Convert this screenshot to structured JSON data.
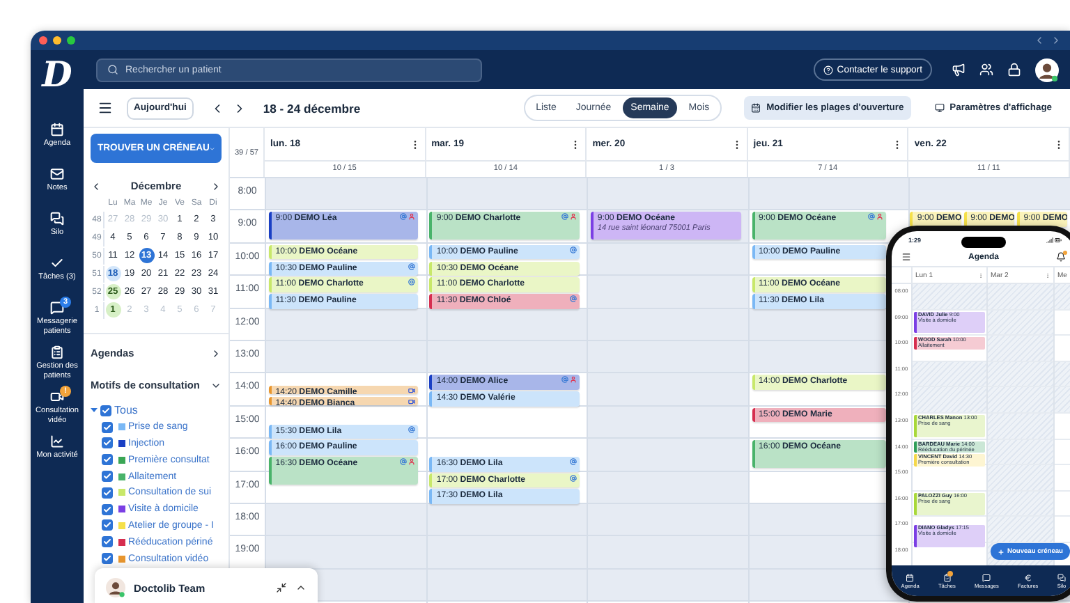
{
  "window": {
    "logo": "D"
  },
  "nav": [
    {
      "label": "Agenda"
    },
    {
      "label": "Notes"
    },
    {
      "label": "Silo"
    },
    {
      "label": "Tâches (3)"
    },
    {
      "label": "Messagerie patients",
      "badge": "3",
      "color": "#2b7de9"
    },
    {
      "label": "Gestion des patients"
    },
    {
      "label": "Consultation vidéo",
      "badge": "!",
      "color": "#f2a33a"
    },
    {
      "label": "Mon activité"
    }
  ],
  "topbar": {
    "search": {
      "placeholder": "Rechercher un patient"
    },
    "support": "Contacter le support"
  },
  "toolbar": {
    "today": "Aujourd'hui",
    "range": "18 - 24 décembre",
    "views": [
      {
        "label": "Liste",
        "selected": false
      },
      {
        "label": "Journée",
        "selected": false
      },
      {
        "label": "Semaine",
        "selected": true
      },
      {
        "label": "Mois",
        "selected": false
      }
    ],
    "edit_hours": "Modifier les plages d'ouverture",
    "display_settings": "Paramètres d'affichage"
  },
  "panel": {
    "find_slot": "TROUVER UN CRÉNEAU",
    "mini_calendar": {
      "month": "Décembre",
      "weekdays": [
        "Lu",
        "Ma",
        "Me",
        "Je",
        "Ve",
        "Sa",
        "Di"
      ],
      "weeks": [
        {
          "number": "48",
          "days": [
            {
              "label": "27",
              "kind": "other"
            },
            {
              "label": "28",
              "kind": "other"
            },
            {
              "label": "29",
              "kind": "other"
            },
            {
              "label": "30",
              "kind": "other"
            },
            {
              "label": "1",
              "kind": "day"
            },
            {
              "label": "2",
              "kind": "day"
            },
            {
              "label": "3",
              "kind": "day"
            }
          ]
        },
        {
          "number": "49",
          "days": [
            {
              "label": "4",
              "kind": "day"
            },
            {
              "label": "5",
              "kind": "day"
            },
            {
              "label": "6",
              "kind": "day"
            },
            {
              "label": "7",
              "kind": "day"
            },
            {
              "label": "8",
              "kind": "day"
            },
            {
              "label": "9",
              "kind": "day"
            },
            {
              "label": "10",
              "kind": "day"
            }
          ]
        },
        {
          "number": "50",
          "days": [
            {
              "label": "11",
              "kind": "day"
            },
            {
              "label": "12",
              "kind": "day"
            },
            {
              "label": "13",
              "kind": "today"
            },
            {
              "label": "14",
              "kind": "day"
            },
            {
              "label": "15",
              "kind": "day"
            },
            {
              "label": "16",
              "kind": "day"
            },
            {
              "label": "17",
              "kind": "day"
            }
          ]
        },
        {
          "number": "51",
          "days": [
            {
              "label": "18",
              "kind": "selected"
            },
            {
              "label": "19",
              "kind": "day"
            },
            {
              "label": "20",
              "kind": "day"
            },
            {
              "label": "21",
              "kind": "day"
            },
            {
              "label": "22",
              "kind": "day"
            },
            {
              "label": "23",
              "kind": "day"
            },
            {
              "label": "24",
              "kind": "day"
            }
          ]
        },
        {
          "number": "52",
          "days": [
            {
              "label": "25",
              "kind": "holiday"
            },
            {
              "label": "26",
              "kind": "day"
            },
            {
              "label": "27",
              "kind": "day"
            },
            {
              "label": "28",
              "kind": "day"
            },
            {
              "label": "29",
              "kind": "day"
            },
            {
              "label": "30",
              "kind": "day"
            },
            {
              "label": "31",
              "kind": "day"
            }
          ]
        },
        {
          "number": "1",
          "days": [
            {
              "label": "1",
              "kind": "holiday"
            },
            {
              "label": "2",
              "kind": "other"
            },
            {
              "label": "3",
              "kind": "other"
            },
            {
              "label": "4",
              "kind": "other"
            },
            {
              "label": "5",
              "kind": "other"
            },
            {
              "label": "6",
              "kind": "other"
            },
            {
              "label": "7",
              "kind": "other"
            }
          ]
        }
      ]
    },
    "agendas": "Agendas",
    "motifs": {
      "title": "Motifs de consultation",
      "all": {
        "label": "Tous",
        "checked": true,
        "expanded": true,
        "children": [
          {
            "label": "Prise de sang",
            "checked": true,
            "color": "#7ab8f5"
          },
          {
            "label": "Injection",
            "checked": true,
            "color": "#1a3fc4"
          },
          {
            "label": "Première consultat",
            "checked": true,
            "color": "#3aa655"
          },
          {
            "label": "Allaitement",
            "checked": true,
            "color": "#49b36a"
          },
          {
            "label": "Consultation de sui",
            "checked": true,
            "color": "#c8e86a"
          },
          {
            "label": "Visite à domicile",
            "checked": true,
            "color": "#7b3fe4"
          },
          {
            "label": "Atelier de groupe - I",
            "checked": true,
            "color": "#f5e04a"
          },
          {
            "label": "Rééducation périné",
            "checked": true,
            "color": "#d62e4f"
          },
          {
            "label": "Consultation vidéo",
            "checked": true,
            "color": "#e8962e"
          }
        ]
      }
    }
  },
  "calendar": {
    "total": "39 / 57",
    "hours": [
      {
        "label": "8:00",
        "open": false
      },
      {
        "label": "9:00",
        "open": true
      },
      {
        "label": "10:00",
        "open": true
      },
      {
        "label": "11:00",
        "open": true
      },
      {
        "label": "12:00",
        "open": false
      },
      {
        "label": "13:00",
        "open": false
      },
      {
        "label": "14:00",
        "open": true
      },
      {
        "label": "15:00",
        "open": true
      },
      {
        "label": "16:00",
        "open": true
      },
      {
        "label": "17:00",
        "open": true
      },
      {
        "label": "18:00",
        "open": false
      },
      {
        "label": "19:00",
        "open": false
      }
    ],
    "days": [
      {
        "label": "lun. 18",
        "count": "10 / 15",
        "open": true,
        "kind": "stack",
        "events": [
          {
            "time": "9:00",
            "name": "DEMO Léa",
            "color": "#1a3fc4",
            "kind": "long",
            "online": true,
            "alert": true,
            "video": false
          },
          {
            "time": "10:00",
            "name": "DEMO Océane",
            "color": "#c8e86a",
            "kind": "short",
            "online": false,
            "alert": false,
            "video": false
          },
          {
            "time": "10:30",
            "name": "DEMO Pauline",
            "color": "#7ab8f5",
            "kind": "short",
            "online": true,
            "alert": false,
            "video": false
          },
          {
            "time": "11:00",
            "name": "DEMO Charlotte",
            "color": "#c8e86a",
            "kind": "short",
            "online": true,
            "alert": false,
            "video": false
          },
          {
            "time": "11:30",
            "name": "DEMO Pauline",
            "color": "#7ab8f5",
            "kind": "short",
            "online": false,
            "alert": false,
            "video": false
          },
          {
            "time": "14:20",
            "name": "DEMO Camille",
            "color": "#e8962e",
            "kind": "tiny",
            "online": false,
            "alert": false,
            "video": true
          },
          {
            "time": "14:40",
            "name": "DEMO Bianca",
            "color": "#e8962e",
            "kind": "tiny",
            "online": false,
            "alert": false,
            "video": true
          },
          {
            "time": "15:30",
            "name": "DEMO Lila",
            "color": "#7ab8f5",
            "kind": "short",
            "online": true,
            "alert": false,
            "video": false
          },
          {
            "time": "16:00",
            "name": "DEMO Pauline",
            "color": "#7ab8f5",
            "kind": "short",
            "online": false,
            "alert": false,
            "video": false
          },
          {
            "time": "16:30",
            "name": "DEMO Océane",
            "color": "#49b36a",
            "kind": "long",
            "online": true,
            "alert": true,
            "video": false
          }
        ]
      },
      {
        "label": "mar. 19",
        "count": "10 / 14",
        "open": true,
        "kind": "stack",
        "events": [
          {
            "time": "9:00",
            "name": "DEMO Charlotte",
            "color": "#49b36a",
            "kind": "long",
            "online": true,
            "alert": true,
            "video": false
          },
          {
            "time": "10:00",
            "name": "DEMO Pauline",
            "color": "#7ab8f5",
            "kind": "short",
            "online": true,
            "alert": false,
            "video": false
          },
          {
            "time": "10:30",
            "name": "DEMO Océane",
            "color": "#c8e86a",
            "kind": "short",
            "online": false,
            "alert": false,
            "video": false
          },
          {
            "time": "11:00",
            "name": "DEMO Charlotte",
            "color": "#c8e86a",
            "kind": "short",
            "online": false,
            "alert": false,
            "video": false
          },
          {
            "time": "11:30",
            "name": "DEMO Chloé",
            "color": "#d62e4f",
            "kind": "short",
            "online": true,
            "alert": false,
            "video": false
          },
          {
            "time": "14:00",
            "name": "DEMO Alice",
            "color": "#1a3fc4",
            "kind": "short",
            "online": true,
            "alert": true,
            "video": false
          },
          {
            "time": "14:30",
            "name": "DEMO Valérie",
            "color": "#7ab8f5",
            "kind": "short",
            "online": false,
            "alert": false,
            "video": false
          },
          {
            "time": "16:30",
            "name": "DEMO Lila",
            "color": "#7ab8f5",
            "kind": "short",
            "online": true,
            "alert": false,
            "video": false
          },
          {
            "time": "17:00",
            "name": "DEMO Charlotte",
            "color": "#c8e86a",
            "kind": "short",
            "online": true,
            "alert": false,
            "video": false
          },
          {
            "time": "17:30",
            "name": "DEMO Lila",
            "color": "#7ab8f5",
            "kind": "short",
            "online": false,
            "alert": false,
            "video": false
          }
        ]
      },
      {
        "label": "mer. 20",
        "count": "1 / 3",
        "open": false,
        "kind": "stack",
        "events": [
          {
            "time": "9:00",
            "name": "DEMO Océane",
            "note": "14 rue saint léonard 75001 Paris",
            "color": "#7b3fe4",
            "kind": "long",
            "online": false,
            "alert": false,
            "video": false
          }
        ]
      },
      {
        "label": "jeu. 21",
        "count": "7 / 14",
        "open": true,
        "kind": "covered",
        "events": [
          {
            "time": "9:00",
            "name": "DEMO Océane",
            "color": "#49b36a",
            "kind": "long",
            "online": true,
            "alert": true,
            "video": false
          },
          {
            "time": "10:00",
            "name": "DEMO Pauline",
            "color": "#7ab8f5",
            "kind": "short",
            "online": false,
            "alert": false,
            "video": false
          },
          {
            "time": "11:00",
            "name": "DEMO Océane",
            "color": "#c8e86a",
            "kind": "short",
            "online": false,
            "alert": false,
            "video": false
          },
          {
            "time": "11:30",
            "name": "DEMO Lila",
            "color": "#7ab8f5",
            "kind": "short",
            "online": false,
            "alert": false,
            "video": false
          },
          {
            "time": "14:00",
            "name": "DEMO Charlotte",
            "color": "#c8e86a",
            "kind": "short",
            "online": false,
            "alert": false,
            "video": false
          },
          {
            "time": "15:00",
            "name": "DEMO Marie",
            "color": "#d62e4f",
            "kind": "short",
            "online": false,
            "alert": false,
            "video": false
          },
          {
            "time": "16:00",
            "name": "DEMO Océane",
            "color": "#49b36a",
            "kind": "long",
            "online": false,
            "alert": false,
            "video": false
          }
        ]
      },
      {
        "label": "ven. 22",
        "count": "11 / 11",
        "open": true,
        "kind": "split",
        "events": [
          {
            "time": "9:00",
            "name": "DEMO",
            "color": "#f5e04a",
            "kind": "short",
            "online": false,
            "alert": false,
            "video": false
          },
          {
            "time": "9:00",
            "name": "DEMO",
            "color": "#f5e04a",
            "kind": "short",
            "online": false,
            "alert": false,
            "video": false
          },
          {
            "time": "9:00",
            "name": "DEMO",
            "color": "#f5e04a",
            "kind": "short",
            "online": false,
            "alert": false,
            "video": false
          }
        ]
      }
    ]
  },
  "chat": {
    "title": "Doctolib Team",
    "online": true
  },
  "phone": {
    "clock": "1:29",
    "title": "Agenda",
    "hours": [
      {
        "label": "08:00",
        "open": false
      },
      {
        "label": "09:00",
        "open": true
      },
      {
        "label": "10:00",
        "open": true
      },
      {
        "label": "11:00",
        "open": false
      },
      {
        "label": "12:00",
        "open": false
      },
      {
        "label": "13:00",
        "open": true
      },
      {
        "label": "14:00",
        "open": true
      },
      {
        "label": "15:00",
        "open": true
      },
      {
        "label": "16:00",
        "open": true
      },
      {
        "label": "17:00",
        "open": true
      },
      {
        "label": "18:00",
        "open": true
      }
    ],
    "days": [
      {
        "label": "Lun  1",
        "open": true,
        "events": [
          {
            "name": "DAVID Julie",
            "time": "9:00",
            "motif": "Visite à domicile",
            "color": "#7b3fe4",
            "kind": "long"
          },
          {
            "name": "WOOD Sarah",
            "time": "10:00",
            "motif": "Allaitement",
            "color": "#d62e4f",
            "kind": "short"
          },
          {
            "name": "CHARLES Manon",
            "time": "13:00",
            "motif": "Prise de sang",
            "color": "#a8d83a",
            "kind": "long"
          },
          {
            "name": "BARDEAU Marie",
            "time": "14:00",
            "motif": "Rééducation du périnée",
            "color": "#2f9e5a",
            "kind": "short"
          },
          {
            "name": "VINCENT David",
            "time": "14:30",
            "motif": "Première consultation",
            "color": "#f5d84a",
            "kind": "short"
          },
          {
            "name": "PALOZZI Guy",
            "time": "16:00",
            "motif": "Prise de sang",
            "color": "#a8d83a",
            "kind": "long"
          },
          {
            "name": "DIANO Gladys",
            "time": "17:15",
            "motif": "Visite à domicile",
            "color": "#7b3fe4",
            "kind": "long"
          }
        ]
      },
      {
        "label": "Mar  2",
        "open": false
      },
      {
        "label": "Me"
      }
    ],
    "new_slot": "Nouveau créneau",
    "tabs": [
      {
        "label": "Agenda",
        "badge": false
      },
      {
        "label": "Tâches",
        "badge": true
      },
      {
        "label": "Messages",
        "badge": false
      },
      {
        "label": "Factures",
        "badge": false
      },
      {
        "label": "Silo",
        "badge": false
      }
    ]
  }
}
